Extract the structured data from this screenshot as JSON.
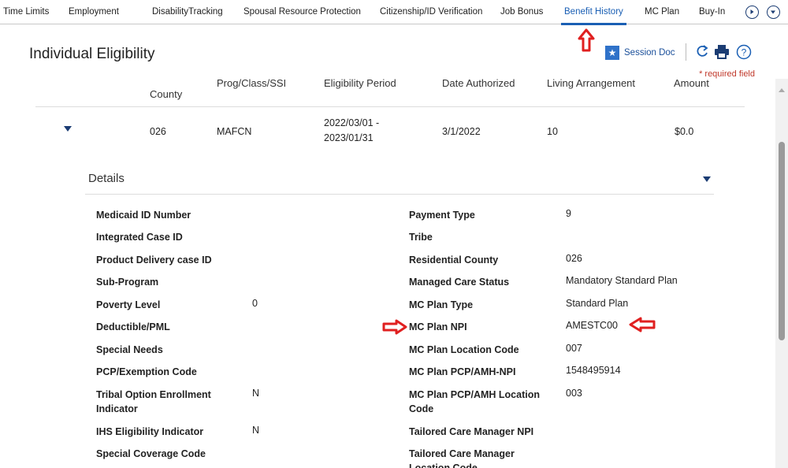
{
  "tabs": [
    {
      "label": "Time Limits",
      "active": false
    },
    {
      "label": "Employment",
      "active": false
    },
    {
      "label": "DisabilityTracking",
      "active": false
    },
    {
      "label": "Spousal Resource Protection",
      "active": false
    },
    {
      "label": "Citizenship/ID Verification",
      "active": false
    },
    {
      "label": "Job Bonus",
      "active": false
    },
    {
      "label": "Benefit History",
      "active": true
    },
    {
      "label": "MC Plan",
      "active": false
    },
    {
      "label": "Buy-In",
      "active": false
    }
  ],
  "header": {
    "title": "Individual Eligibility",
    "session_doc": "Session Doc",
    "required_note": "* required field"
  },
  "table": {
    "headers": {
      "county": "County",
      "prog": "Prog/Class/SSI",
      "period": "Eligibility Period",
      "authorized": "Date Authorized",
      "living": "Living Arrangement",
      "amount": "Amount"
    },
    "row": {
      "county": "026",
      "prog": "MAFCN",
      "period_line1": "2022/03/01 -",
      "period_line2": "2023/01/31",
      "authorized": "3/1/2022",
      "living": "10",
      "amount": "$0.0"
    }
  },
  "details": {
    "title": "Details",
    "left": [
      {
        "label": "Medicaid ID Number",
        "value": ""
      },
      {
        "label": "Integrated Case ID",
        "value": ""
      },
      {
        "label": "Product Delivery case ID",
        "value": ""
      },
      {
        "label": "Sub-Program",
        "value": ""
      },
      {
        "label": "Poverty Level",
        "value": "0"
      },
      {
        "label": "Deductible/PML",
        "value": ""
      },
      {
        "label": "Special Needs",
        "value": ""
      },
      {
        "label": "PCP/Exemption Code",
        "value": ""
      },
      {
        "label_line1": "Tribal Option Enrollment",
        "label_line2": "Indicator",
        "value": "N"
      },
      {
        "label": "IHS Eligibility Indicator",
        "value": "N"
      },
      {
        "label": "Special Coverage Code",
        "value": ""
      }
    ],
    "right": [
      {
        "label": "Payment Type",
        "value": "9"
      },
      {
        "label": "Tribe",
        "value": ""
      },
      {
        "label": "Residential County",
        "value": "026"
      },
      {
        "label": "Managed Care Status",
        "value": "Mandatory Standard Plan"
      },
      {
        "label": "MC Plan Type",
        "value": "Standard Plan"
      },
      {
        "label": "MC Plan NPI",
        "value": "AMESTC00"
      },
      {
        "label": "MC Plan Location Code",
        "value": "007"
      },
      {
        "label": "MC Plan PCP/AMH-NPI",
        "value": "1548495914"
      },
      {
        "label_line1": "MC Plan PCP/AMH Location",
        "label_line2": "Code",
        "value": "003"
      },
      {
        "label": "Tailored Care Manager NPI",
        "value": ""
      },
      {
        "label_line1": "Tailored Care Manager",
        "label_line2": "Location Code",
        "value": ""
      }
    ]
  },
  "colors": {
    "accent": "#1a5fb4",
    "annotation": "#e02020",
    "required": "#c0392b"
  },
  "icons": [
    "play-circle-icon",
    "dropdown-circle-icon",
    "star-icon",
    "refresh-icon",
    "print-icon",
    "help-icon",
    "caret-down-icon"
  ]
}
